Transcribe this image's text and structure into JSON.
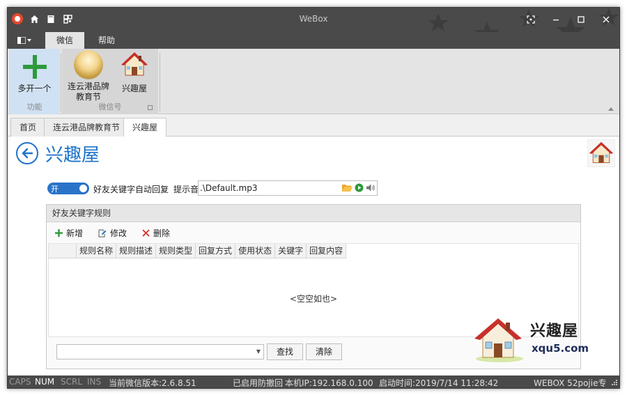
{
  "window": {
    "title": "WeBox"
  },
  "ribbon": {
    "tabs": [
      {
        "label": "微信",
        "active": true
      },
      {
        "label": "帮助",
        "active": false
      }
    ],
    "groups": {
      "function": {
        "label": "功能",
        "buttons": [
          {
            "label": "多开一个",
            "icon": "plus-icon"
          }
        ]
      },
      "wechat": {
        "label": "微信号",
        "buttons": [
          {
            "label_line1": "连云港品牌",
            "label_line2": "教育节",
            "icon": "avatar-icon"
          },
          {
            "label": "兴趣屋",
            "icon": "house-icon"
          }
        ]
      }
    }
  },
  "doc_tabs": [
    {
      "label": "首页",
      "active": false
    },
    {
      "label": "连云港品牌教育节",
      "active": false
    },
    {
      "label": "兴趣屋",
      "active": true
    }
  ],
  "page": {
    "title": "兴趣屋",
    "auto_reply": {
      "toggle_label": "开",
      "on": true,
      "label": "好友关键字自动回复"
    },
    "tone": {
      "label": "提示音",
      "value": ".\\Default.mp3"
    }
  },
  "rules": {
    "title": "好友关键字规则",
    "toolbar": {
      "add": "新增",
      "edit": "修改",
      "delete": "删除"
    },
    "columns": [
      "规则名称",
      "规则描述",
      "规则类型",
      "回复方式",
      "使用状态",
      "关键字",
      "回复内容"
    ],
    "rows": [],
    "empty_text": "<空空如也>",
    "filter": {
      "value": "",
      "placeholder": ""
    },
    "search_label": "查找",
    "clear_label": "清除"
  },
  "watermark": {
    "text": "兴趣屋",
    "url": "xqu5.com"
  },
  "status_bar": {
    "caps": "CAPS",
    "num": "NUM",
    "scrl": "SCRL",
    "ins": "INS",
    "version": "当前微信版本:2.6.8.51",
    "anti_revoke": "已启用防撤回",
    "local_ip": "本机IP:192.168.0.100",
    "start_time": "启动时间:2019/7/14 11:28:42",
    "edition": "WEBOX 52pojie专"
  },
  "colors": {
    "accent": "#1e74c8",
    "titlebar": "#4a4a4a",
    "ribbon": "#e4e4e4",
    "func_group": "#cfe1f2",
    "add_green": "#2e9a3a",
    "delete_red": "#d93025"
  }
}
